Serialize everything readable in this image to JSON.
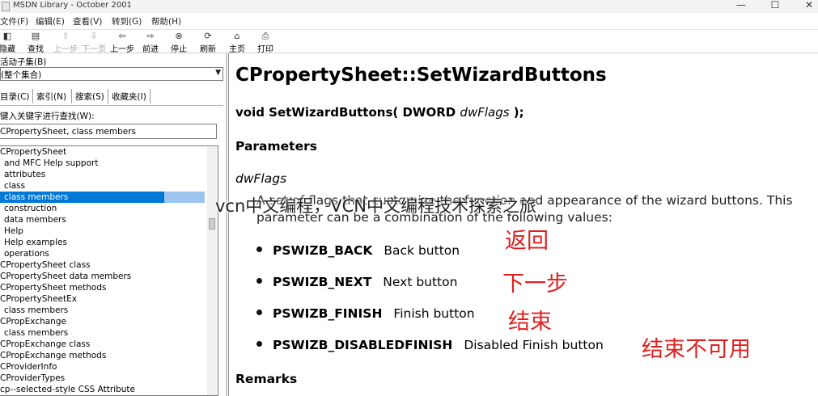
{
  "window": {
    "title": "MSDN Library - October 2001",
    "min": "—",
    "max": "☐",
    "close": "✕"
  },
  "menu": [
    "文件(F)",
    "编辑(E)",
    "查看(V)",
    "转到(G)",
    "帮助(H)"
  ],
  "toolbar": [
    {
      "label": "隐藏",
      "icon": "hide-icon",
      "glyph": "◧",
      "enabled": true
    },
    {
      "label": "查找",
      "icon": "find-icon",
      "glyph": "▤",
      "enabled": true
    },
    {
      "label": "上一步",
      "icon": "up-arrow-icon",
      "glyph": "⇧",
      "enabled": false
    },
    {
      "label": "下一页",
      "icon": "down-arrow-icon",
      "glyph": "⇩",
      "enabled": false
    },
    {
      "label": "上一步",
      "icon": "back-icon",
      "glyph": "⇦",
      "enabled": true
    },
    {
      "label": "前进",
      "icon": "forward-icon",
      "glyph": "⇨",
      "enabled": true
    },
    {
      "label": "停止",
      "icon": "stop-icon",
      "glyph": "⊗",
      "enabled": true
    },
    {
      "label": "刷新",
      "icon": "refresh-icon",
      "glyph": "⟳",
      "enabled": true
    },
    {
      "label": "主页",
      "icon": "home-icon",
      "glyph": "⌂",
      "enabled": true
    },
    {
      "label": "打印",
      "icon": "print-icon",
      "glyph": "⎙",
      "enabled": true
    }
  ],
  "left": {
    "subset_label": "活动子集(B)",
    "subset_value": "(整个集合)",
    "tabs": [
      "目录(C)",
      "索引(N)",
      "搜索(S)",
      "收藏夹(I)"
    ],
    "keyword_label": "键入关键字进行查找(W):",
    "keyword_value": "CPropertySheet, class members",
    "items": [
      {
        "text": "CPropertySheet",
        "indent": false
      },
      {
        "text": "and MFC Help support",
        "indent": true
      },
      {
        "text": "attributes",
        "indent": true
      },
      {
        "text": "class",
        "indent": true
      },
      {
        "text": "class members",
        "indent": true,
        "selected": true
      },
      {
        "text": "construction",
        "indent": true
      },
      {
        "text": "data members",
        "indent": true
      },
      {
        "text": "Help",
        "indent": true
      },
      {
        "text": "Help examples",
        "indent": true
      },
      {
        "text": "operations",
        "indent": true
      },
      {
        "text": "CPropertySheet class",
        "indent": false
      },
      {
        "text": "CPropertySheet data members",
        "indent": false
      },
      {
        "text": "CPropertySheet methods",
        "indent": false
      },
      {
        "text": "CPropertySheetEx",
        "indent": false
      },
      {
        "text": "class members",
        "indent": true
      },
      {
        "text": "CPropExchange",
        "indent": false
      },
      {
        "text": "class members",
        "indent": true
      },
      {
        "text": "CPropExchange class",
        "indent": false
      },
      {
        "text": "CPropExchange methods",
        "indent": false
      },
      {
        "text": "CProviderInfo",
        "indent": false
      },
      {
        "text": "CProviderTypes",
        "indent": false
      },
      {
        "text": "cp--selected-style CSS Attribute",
        "indent": false
      }
    ]
  },
  "doc": {
    "title": "CPropertySheet::SetWizardButtons",
    "sig_pre": "void SetWizardButtons( DWORD ",
    "sig_param": "dwFlags",
    "sig_post": " );",
    "params_heading": "Parameters",
    "param_name": "dwFlags",
    "desc_line1": "A set of flags that customize the function and appearance of the wizard buttons. This",
    "desc_line2": "parameter can be a combination of the following values:",
    "flags": [
      {
        "name": "PSWIZB_BACK",
        "desc": "Back button",
        "note": "返回"
      },
      {
        "name": "PSWIZB_NEXT",
        "desc": "Next button",
        "note": "下一步"
      },
      {
        "name": "PSWIZB_FINISH",
        "desc": "Finish button",
        "note": "结束"
      },
      {
        "name": "PSWIZB_DISABLEDFINISH",
        "desc": "Disabled Finish button",
        "note": "结束不可用"
      }
    ],
    "remarks_heading": "Remarks"
  },
  "watermark": "vcn中文编程，VCN中文编程技术探索之旅"
}
